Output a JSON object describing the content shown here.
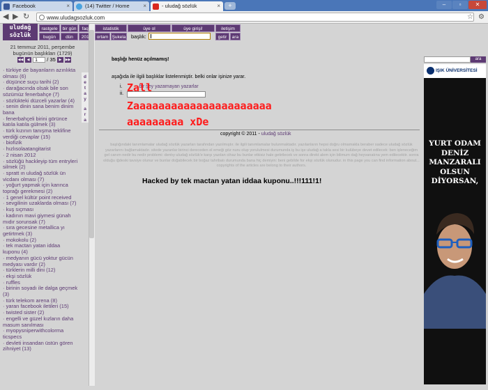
{
  "browser": {
    "tabs": [
      {
        "title": "Facebook",
        "color": "#3b5998"
      },
      {
        "title": "(14) Twitter / Home",
        "color": "#4aa3df"
      },
      {
        "title": "- uludağ sözlük",
        "color": "#d9281e"
      }
    ],
    "url": "www.uludagsozluk.com"
  },
  "site": {
    "logo_line1": "uludağ",
    "logo_line2": "sözlük",
    "nav_row1": [
      "rastgele",
      "bir gün",
      "faq?",
      "istatistik",
      "üye ol",
      "üye girişi!",
      "iletişim"
    ],
    "nav_row2": [
      "bugün",
      "dün",
      "2010",
      "ortam",
      "Şukela"
    ],
    "baslik_label": "başlık:",
    "getir": "getir",
    "ara": "ara"
  },
  "sidebar": {
    "date_line1": "21 temmuz 2011, perşembe",
    "date_line2": "bugünün başlıkları (1729)",
    "page_current": "1",
    "page_total": "/ 35",
    "detay_label": "d e t a y",
    "ara_label": "a r a",
    "items": [
      "türkiye de bayanların azınlıkta olması (6)",
      "düşünce suçu tarihi (2)",
      "darağacında olsak bile son sözümüz fenerbahçe (7)",
      "sözlükteki düzceli yazarlar (4)",
      "senin dinin sana benim dinim bana",
      "fenerbahçeli birini görünce katıla katıla gülmek (3)",
      "türk kızının tanışma teklifine verdiği cevaplar (15)",
      "biofizik",
      "hızlısolaatangitarist",
      "2 nisan 2012",
      "sözlüğü hackleyip tüm entryleri silmek (2)",
      "spratt ın uludağ sözlük ün vicdanı olması (7)",
      "yoğurt yapmak için karınca toprağı gerekmesi (2)",
      "1 genel kültür point received",
      "sevgilinin uzaklarda olması (7)",
      "kuş sıçması",
      "kadının mavi giymesi günah mıdır sorunsak (7)",
      "sıra gecesine metallica yı getirtmek (3)",
      "mokokolu (2)",
      "tek mactan yatan iddaa kuponu (4)",
      "medyanın gücü yoktur gücün medyası vardır (2)",
      "türklerin milli dini (12)",
      "ekşi sözlük",
      "ruffles",
      "birinin soyadı ile dalga geçmek (3)",
      "türk telekom arena (8)",
      "yaran facebook iletileri (15)",
      "twisted sister (2)",
      "engelli ve güzel kızların daha masum sanılması",
      "myopysniperwithcolorma ticspecs",
      "devleti insandan üstün gören zihniyet (13)"
    ]
  },
  "main": {
    "title": "başlığı henüz açılmamış!",
    "suggest_text": "aşağıda ile ilgili başlıklar listelenmiştir. belki onlar işinize yarar.",
    "suggestions": [
      {
        "num": "i.",
        "text": "bir şey yazamayan yazarlar"
      },
      {
        "num": "ii.",
        "text": ""
      }
    ],
    "hack_line1": "Zall",
    "hack_line2": "Zaaaaaaaaaaaaaaaaaaaaaa",
    "hack_line3": "aaaaaaaaa xDe",
    "copyright_prefix": "copyright © 2011 - ",
    "copyright_link": "uludağ sözlük",
    "disclaimer": "başlığındaki tanımlamalar uludağ sözlük yazarları tarafından yazılmıştır. ile ilgili tanımlamalar bulunmaktadır. yazılanların hepsi doğru olmamakla beraber sadece uludağ sözlük yazarlarını bağlamaktadır. sitede yazanlar birinci dereceden el emeği göz nuru olup yorululmesi durumunda iş bu işe uludağ a takla sesi bir kulübeye devet edilecek: ben işleneceğim gel canım nedir bu nedir problemi: dentıy uludağ sözlük'e karşı yazılan cihaz bu bunlar etkisiz hale getirilecek ve sonra direkt alem için bilimum dağ heyvanatına yem edilecektir. sonra olduğu iğdeski tavsiye olunur ve bunlar doğabilecek bir boğaz tahribatı durumunda bana hiç demiyin: beni gebilde for ekşi sözlük olunudur. in this page you can find information about... copyrights of the articles are belong to their authors.",
    "hacked_text": "Hacked by tek mactan yatan iddaa kuponu..!!!111!1!"
  },
  "right": {
    "search_button": "ara",
    "ad_university": "IŞIK ÜNİVERSİTESİ",
    "ad_slogan": [
      "YURT ODAM",
      "DENİZ",
      "MANZARALI",
      "OLSUN",
      "DİYORSAN,"
    ]
  },
  "colors": {
    "brand": "#5d3a73",
    "hack_red": "#ff1a1a",
    "page_bg": "#d4d4d4"
  }
}
